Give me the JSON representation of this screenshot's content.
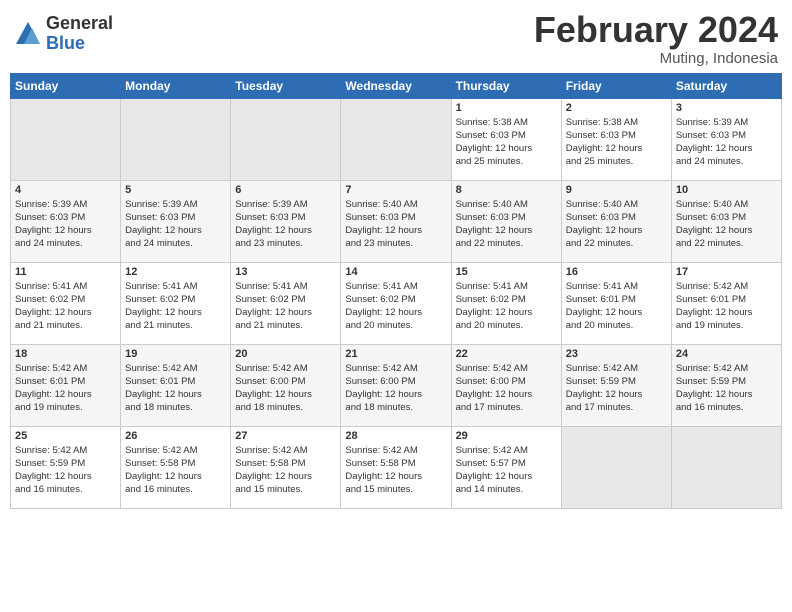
{
  "header": {
    "logo_general": "General",
    "logo_blue": "Blue",
    "month_title": "February 2024",
    "location": "Muting, Indonesia"
  },
  "weekdays": [
    "Sunday",
    "Monday",
    "Tuesday",
    "Wednesday",
    "Thursday",
    "Friday",
    "Saturday"
  ],
  "weeks": [
    [
      {
        "day": "",
        "empty": true
      },
      {
        "day": "",
        "empty": true
      },
      {
        "day": "",
        "empty": true
      },
      {
        "day": "",
        "empty": true
      },
      {
        "day": "1",
        "sunrise": "5:38 AM",
        "sunset": "6:03 PM",
        "daylight": "12 hours and 25 minutes."
      },
      {
        "day": "2",
        "sunrise": "5:38 AM",
        "sunset": "6:03 PM",
        "daylight": "12 hours and 25 minutes."
      },
      {
        "day": "3",
        "sunrise": "5:39 AM",
        "sunset": "6:03 PM",
        "daylight": "12 hours and 24 minutes."
      }
    ],
    [
      {
        "day": "4",
        "sunrise": "5:39 AM",
        "sunset": "6:03 PM",
        "daylight": "12 hours and 24 minutes."
      },
      {
        "day": "5",
        "sunrise": "5:39 AM",
        "sunset": "6:03 PM",
        "daylight": "12 hours and 24 minutes."
      },
      {
        "day": "6",
        "sunrise": "5:39 AM",
        "sunset": "6:03 PM",
        "daylight": "12 hours and 23 minutes."
      },
      {
        "day": "7",
        "sunrise": "5:40 AM",
        "sunset": "6:03 PM",
        "daylight": "12 hours and 23 minutes."
      },
      {
        "day": "8",
        "sunrise": "5:40 AM",
        "sunset": "6:03 PM",
        "daylight": "12 hours and 22 minutes."
      },
      {
        "day": "9",
        "sunrise": "5:40 AM",
        "sunset": "6:03 PM",
        "daylight": "12 hours and 22 minutes."
      },
      {
        "day": "10",
        "sunrise": "5:40 AM",
        "sunset": "6:03 PM",
        "daylight": "12 hours and 22 minutes."
      }
    ],
    [
      {
        "day": "11",
        "sunrise": "5:41 AM",
        "sunset": "6:02 PM",
        "daylight": "12 hours and 21 minutes."
      },
      {
        "day": "12",
        "sunrise": "5:41 AM",
        "sunset": "6:02 PM",
        "daylight": "12 hours and 21 minutes."
      },
      {
        "day": "13",
        "sunrise": "5:41 AM",
        "sunset": "6:02 PM",
        "daylight": "12 hours and 21 minutes."
      },
      {
        "day": "14",
        "sunrise": "5:41 AM",
        "sunset": "6:02 PM",
        "daylight": "12 hours and 20 minutes."
      },
      {
        "day": "15",
        "sunrise": "5:41 AM",
        "sunset": "6:02 PM",
        "daylight": "12 hours and 20 minutes."
      },
      {
        "day": "16",
        "sunrise": "5:41 AM",
        "sunset": "6:01 PM",
        "daylight": "12 hours and 20 minutes."
      },
      {
        "day": "17",
        "sunrise": "5:42 AM",
        "sunset": "6:01 PM",
        "daylight": "12 hours and 19 minutes."
      }
    ],
    [
      {
        "day": "18",
        "sunrise": "5:42 AM",
        "sunset": "6:01 PM",
        "daylight": "12 hours and 19 minutes."
      },
      {
        "day": "19",
        "sunrise": "5:42 AM",
        "sunset": "6:01 PM",
        "daylight": "12 hours and 18 minutes."
      },
      {
        "day": "20",
        "sunrise": "5:42 AM",
        "sunset": "6:00 PM",
        "daylight": "12 hours and 18 minutes."
      },
      {
        "day": "21",
        "sunrise": "5:42 AM",
        "sunset": "6:00 PM",
        "daylight": "12 hours and 18 minutes."
      },
      {
        "day": "22",
        "sunrise": "5:42 AM",
        "sunset": "6:00 PM",
        "daylight": "12 hours and 17 minutes."
      },
      {
        "day": "23",
        "sunrise": "5:42 AM",
        "sunset": "5:59 PM",
        "daylight": "12 hours and 17 minutes."
      },
      {
        "day": "24",
        "sunrise": "5:42 AM",
        "sunset": "5:59 PM",
        "daylight": "12 hours and 16 minutes."
      }
    ],
    [
      {
        "day": "25",
        "sunrise": "5:42 AM",
        "sunset": "5:59 PM",
        "daylight": "12 hours and 16 minutes."
      },
      {
        "day": "26",
        "sunrise": "5:42 AM",
        "sunset": "5:58 PM",
        "daylight": "12 hours and 16 minutes."
      },
      {
        "day": "27",
        "sunrise": "5:42 AM",
        "sunset": "5:58 PM",
        "daylight": "12 hours and 15 minutes."
      },
      {
        "day": "28",
        "sunrise": "5:42 AM",
        "sunset": "5:58 PM",
        "daylight": "12 hours and 15 minutes."
      },
      {
        "day": "29",
        "sunrise": "5:42 AM",
        "sunset": "5:57 PM",
        "daylight": "12 hours and 14 minutes."
      },
      {
        "day": "",
        "empty": true
      },
      {
        "day": "",
        "empty": true
      }
    ]
  ],
  "labels": {
    "sunrise": "Sunrise:",
    "sunset": "Sunset:",
    "daylight": "Daylight:"
  }
}
